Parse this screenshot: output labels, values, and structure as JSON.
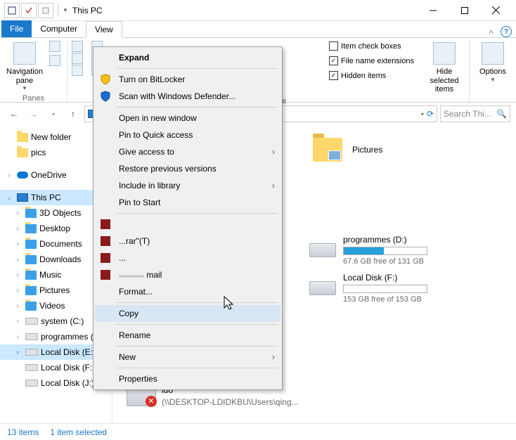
{
  "titlebar": {
    "title": "This PC"
  },
  "tabs": {
    "file": "File",
    "computer": "Computer",
    "view": "View"
  },
  "ribbon": {
    "panes_group": "Panes",
    "showhide_group": "Show/hide",
    "navigation_pane": "Navigation pane",
    "item_checkboxes": "Item check boxes",
    "file_ext": "File name extensions",
    "hidden_items": "Hidden items",
    "hide_selected": "Hide selected items",
    "options": "Options"
  },
  "address": {
    "refresh": "",
    "dropdown": ""
  },
  "search": {
    "placeholder": "Search Thi..."
  },
  "tree": {
    "newfolder": "New folder",
    "pics": "pics",
    "onedrive": "OneDrive",
    "thispc": "This PC",
    "objects3d": "3D Objects",
    "desktop": "Desktop",
    "documents": "Documents",
    "downloads": "Downloads",
    "music": "Music",
    "pictures": "Pictures",
    "videos": "Videos",
    "systemc": "system (C:)",
    "programmes": "programmes (",
    "localdisk_e": "Local Disk (E:)",
    "localdisk_f": "Local Disk (F:)",
    "localdisk_j": "Local Disk (J:)"
  },
  "content": {
    "pictures_label": "Pictures",
    "drive_d": {
      "name": "programmes (D:)",
      "free": "67.6 GB free of 131 GB",
      "pct": 48
    },
    "drive_f": {
      "name": "Local Disk (F:)",
      "free": "153 GB free of 153 GB",
      "pct": 0
    },
    "netloc": {
      "name": "luo",
      "path": "(\\\\DESKTOP-LDIDKBU\\Users\\qing..."
    }
  },
  "status": {
    "items": "13 items",
    "selected": "1 item selected"
  },
  "ctx": {
    "expand": "Expand",
    "bitlocker": "Turn on BitLocker",
    "defender": "Scan with Windows Defender...",
    "open_new": "Open in new window",
    "pin_quick": "Pin to Quick access",
    "give_access": "Give access to",
    "restore_prev": "Restore previous versions",
    "include_lib": "Include in library",
    "pin_start": "Pin to Start",
    "rar_a": "",
    "rar_b": "...rar\"(T)",
    "rar_c": "...",
    "rar_d": "mail",
    "format": "Format...",
    "copy": "Copy",
    "rename": "Rename",
    "new": "New",
    "properties": "Properties"
  }
}
